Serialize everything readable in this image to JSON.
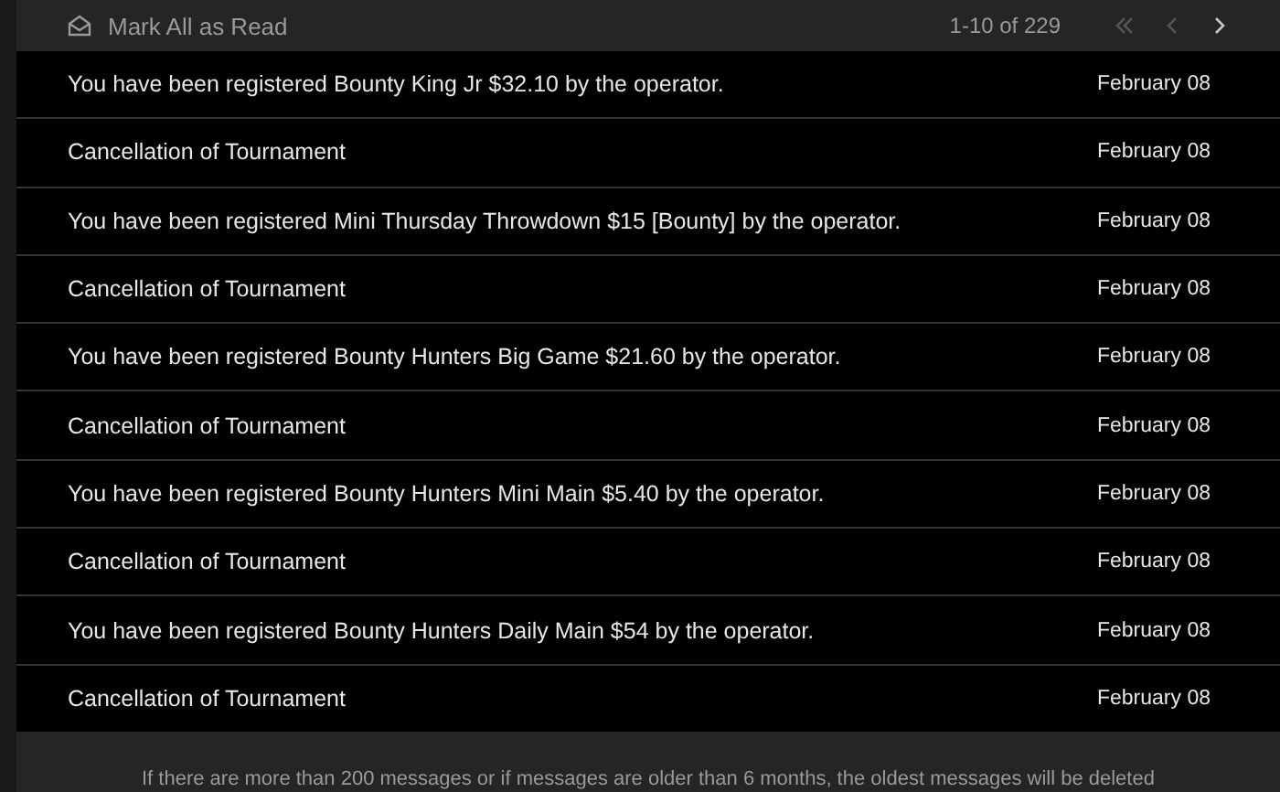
{
  "toolbar": {
    "mark_all": "Mark All as Read",
    "range": "1-10 of 229",
    "pager": [
      {
        "kind": "first",
        "disabled": true
      },
      {
        "kind": "prev",
        "disabled": true
      },
      {
        "kind": "next",
        "disabled": false
      }
    ]
  },
  "messages": [
    {
      "text": "You have been registered Bounty King Jr $32.10 by the operator.",
      "date": "February 08"
    },
    {
      "text": "Cancellation of Tournament",
      "date": "February 08"
    },
    {
      "text": "You have been registered Mini Thursday Throwdown $15 [Bounty] by the operator.",
      "date": "February 08"
    },
    {
      "text": "Cancellation of Tournament",
      "date": "February 08"
    },
    {
      "text": "You have been registered Bounty Hunters Big Game $21.60 by the operator.",
      "date": "February 08"
    },
    {
      "text": "Cancellation of Tournament",
      "date": "February 08"
    },
    {
      "text": "You have been registered Bounty Hunters Mini Main $5.40 by the operator.",
      "date": "February 08"
    },
    {
      "text": "Cancellation of Tournament",
      "date": "February 08"
    },
    {
      "text": "You have been registered Bounty Hunters Daily Main $54 by the operator.",
      "date": "February 08"
    },
    {
      "text": "Cancellation of Tournament",
      "date": "February 08"
    }
  ],
  "footer": "If there are more than 200 messages or if messages are older than 6 months, the oldest messages will be deleted"
}
